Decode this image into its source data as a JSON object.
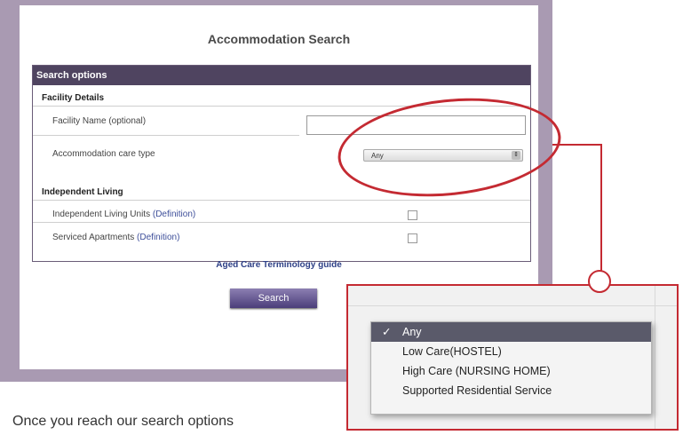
{
  "page": {
    "title": "Accommodation Search",
    "caption": "Once you reach our search options"
  },
  "search_options": {
    "header": "Search options",
    "facility_details": {
      "heading": "Facility Details",
      "facility_name_label": "Facility Name (optional)",
      "facility_name_value": "",
      "care_type_label": "Accommodation care type",
      "care_type_value": "Any"
    },
    "independent_living": {
      "heading": "Independent Living",
      "units_label": "Independent Living Units",
      "apartments_label": "Serviced Apartments",
      "definition_link": "(Definition)"
    },
    "guide_link": "Aged Care Terminology guide",
    "search_button": "Search"
  },
  "dropdown": {
    "options": [
      {
        "label": "Any",
        "selected": true,
        "check": "✓"
      },
      {
        "label": "Low Care(HOSTEL)",
        "selected": false
      },
      {
        "label": "High Care (NURSING HOME)",
        "selected": false
      },
      {
        "label": "Supported Residential Service",
        "selected": false
      }
    ]
  },
  "colors": {
    "frame": "#a99ab2",
    "header_bar": "#4f4460",
    "highlight": "#c42a32",
    "link": "#3e4f9a"
  }
}
